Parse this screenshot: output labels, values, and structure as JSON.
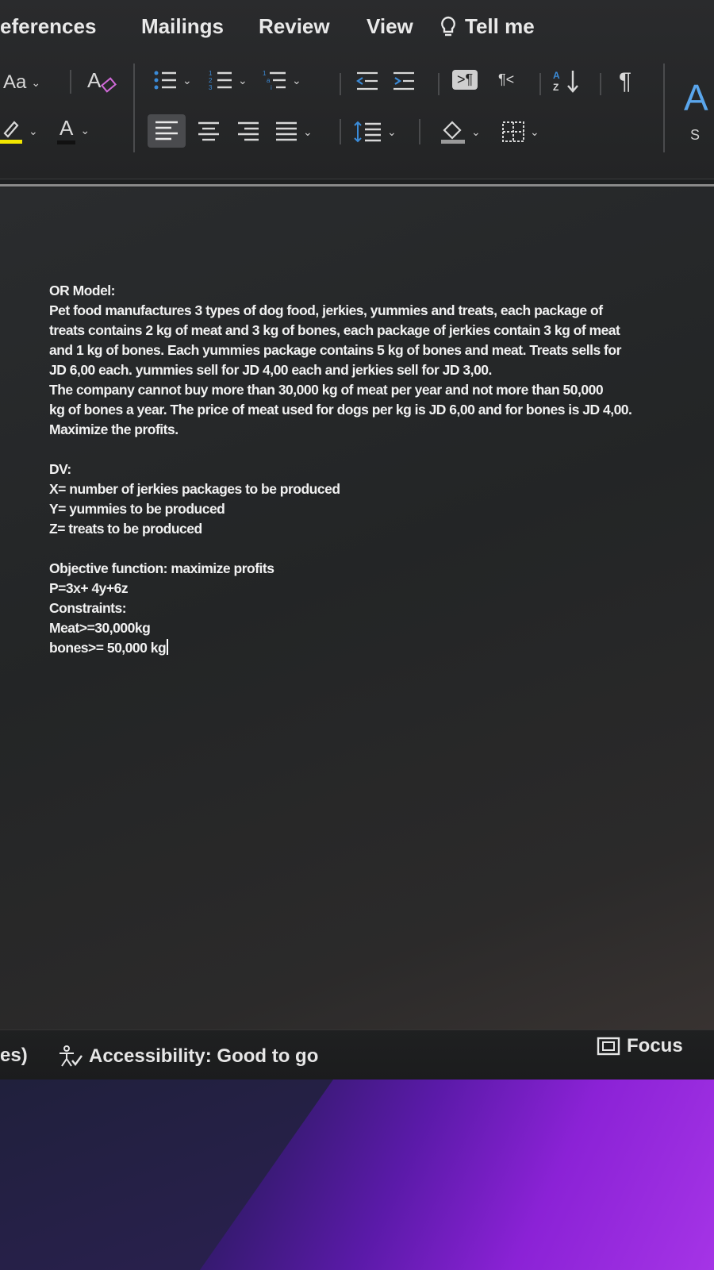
{
  "ribbon": {
    "tabs": [
      "eferences",
      "Mailings",
      "Review",
      "View",
      "Tell me"
    ],
    "styles_pane_partial_label": "S"
  },
  "document": {
    "title": "OR Model:",
    "paragraph1_lines": [
      "Pet food manufactures 3 types of dog food, jerkies, yummies and treats, each package of",
      "treats contains 2 kg of meat and 3 kg of bones, each package of jerkies contain 3 kg of meat",
      "and 1 kg of bones. Each yummies package contains 5 kg of bones and meat. Treats sells for",
      "JD 6,00 each. yummies sell for JD 4,00 each and jerkies sell for JD 3,00."
    ],
    "paragraph2_lines": [
      "The company cannot buy more than 30,000 kg of meat per year and not more than 50,000",
      "kg of bones a year. The price of meat used for dogs per kg is JD 6,00 and for bones is JD 4,00.",
      "Maximize the profits."
    ],
    "dv_heading": "DV:",
    "dv_lines": [
      "X= number of jerkies packages to be produced",
      "Y= yummies to be produced",
      "Z= treats to be produced"
    ],
    "objective_heading": "Objective function: maximize profits",
    "objective": "P=3x+ 4y+6z",
    "constraints_heading": "Constraints:",
    "constraints": [
      "Meat>=30,000kg",
      "bones>= 50,000 kg"
    ]
  },
  "status_bar": {
    "left_partial": "es)",
    "accessibility": "Accessibility: Good to go",
    "focus": "Focus"
  },
  "colors": {
    "ribbon_bg": "#2a2b2d",
    "document_bg": "#232526",
    "wallpaper_accent": "#8b22d6",
    "highlight_yellow": "#f2e600",
    "accent_blue": "#3b8bd8"
  }
}
